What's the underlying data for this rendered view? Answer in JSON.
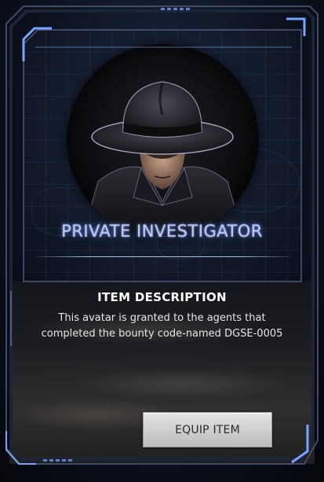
{
  "item": {
    "title": "PRIVATE INVESTIGATOR",
    "icon": "detective-avatar-icon"
  },
  "description": {
    "heading": "ITEM DESCRIPTION",
    "text": "This avatar is granted to the agents that completed the bounty code-named DGSE-0005"
  },
  "actions": {
    "equip_label": "EQUIP ITEM"
  },
  "colors": {
    "title_glow": "#b7c9ff",
    "frame_accent": "#6f98ff",
    "button_bg": "#d4d4d4"
  }
}
